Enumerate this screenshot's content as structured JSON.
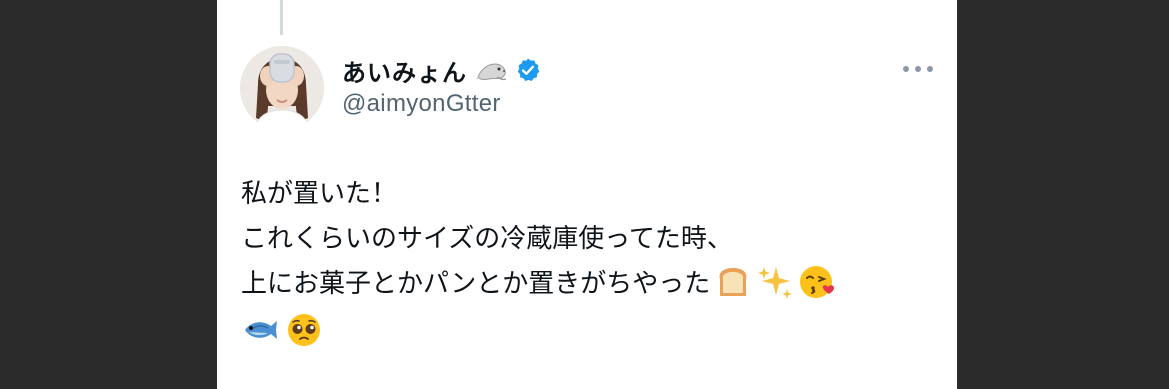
{
  "tweet": {
    "author": {
      "display_name": "あいみょん",
      "handle": "@aimyonGtter",
      "name_emoji": "seal-icon",
      "verified": true,
      "verified_color": "#1d9bf0"
    },
    "text_lines": [
      "私が置いた！",
      "これくらいのサイズの冷蔵庫使ってた時、",
      "上にお菓子とかパンとか置きがちやった"
    ],
    "line3_emojis": [
      "bread-icon",
      "sparkles-icon",
      "face-blowing-kiss-icon"
    ],
    "line4_emojis": [
      "fish-icon",
      "pleading-face-icon"
    ]
  },
  "colors": {
    "page_background": "#2b2b2b",
    "card_background": "#ffffff",
    "text_primary": "#0f1419",
    "text_secondary": "#536471",
    "thread_line": "#cfd9de"
  }
}
